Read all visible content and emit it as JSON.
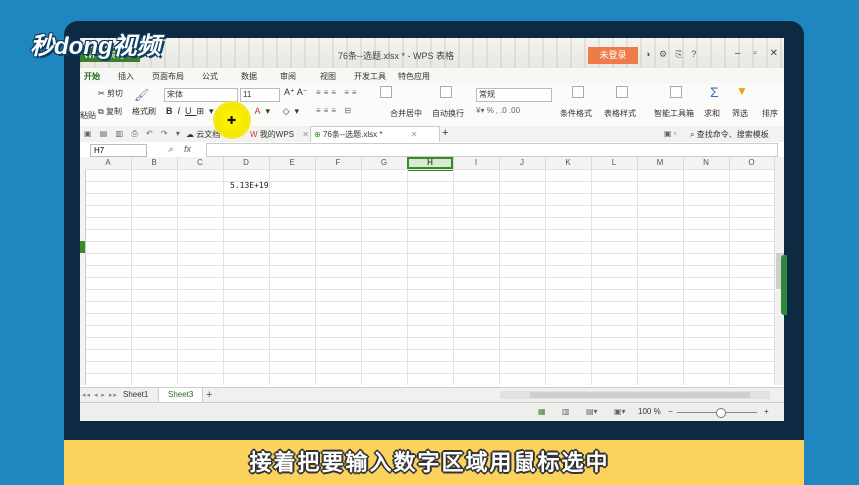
{
  "overlay": {
    "logo_text": "秒dong视频",
    "caption": "接着把要输入数字区域用鼠标选中"
  },
  "titlebar": {
    "app_tab": "WPS 表格 ▾",
    "doc_title": "76条--选题.xlsx * - WPS 表格",
    "login_label": "未登录"
  },
  "menu": {
    "items": [
      "开始",
      "插入",
      "页面布局",
      "公式",
      "数据",
      "审阅",
      "视图",
      "开发工具",
      "特色应用"
    ]
  },
  "ribbon": {
    "paste": "粘贴",
    "cut": "剪切",
    "copy": "复制",
    "format_painter": "格式刷",
    "font_name": "宋体",
    "font_size": "11",
    "merge_center": "合并居中",
    "wrap_text": "自动换行",
    "number_format": "常规",
    "conditional_format": "条件格式",
    "table_style": "表格样式",
    "smart_toolbox": "智能工具箱",
    "sum": "求和",
    "filter": "筛选",
    "sort": "排序"
  },
  "tabs": {
    "cloud_docs": "云文档",
    "my_wps": "我的WPS",
    "current_file": "76条--选题.xlsx *",
    "search_placeholder": "查找命令、搜索模板"
  },
  "formula_bar": {
    "name_box": "H7",
    "fx_label": "fx",
    "formula": ""
  },
  "grid": {
    "columns": [
      "A",
      "B",
      "C",
      "D",
      "E",
      "F",
      "G",
      "H",
      "I",
      "J",
      "K",
      "L",
      "M",
      "N",
      "O"
    ],
    "selected_column": "H",
    "selected_cell": "H7",
    "cell_D2_value": "5.13E+19"
  },
  "sheets": {
    "tabs": [
      "Sheet1",
      "Sheet3"
    ],
    "active": "Sheet3",
    "add_label": "+"
  },
  "status": {
    "zoom": "100 %",
    "zoom_minus": "−",
    "zoom_plus": "+"
  },
  "colors": {
    "accent_green": "#3b8a2a",
    "login_orange": "#ee7c4a",
    "caption_yellow": "#fbd25c",
    "frame_blue": "#1f86bf"
  }
}
